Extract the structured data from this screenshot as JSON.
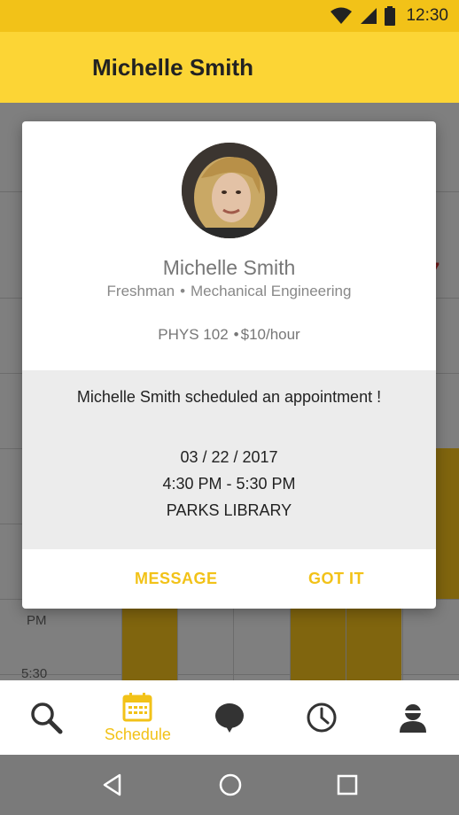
{
  "status_bar": {
    "time": "12:30"
  },
  "app_bar": {
    "title": "Michelle Smith"
  },
  "background": {
    "time_labels": [
      "PM",
      "5:30"
    ],
    "partial_date_digit": "7"
  },
  "dialog": {
    "name": "Michelle Smith",
    "year": "Freshman",
    "major": "Mechanical Engineering",
    "course": "PHYS 102",
    "rate": "$10/hour",
    "message": "Michelle Smith scheduled an appointment !",
    "date": "03 / 22 / 2017",
    "time_range": "4:30 PM - 5:30 PM",
    "location": "PARKS LIBRARY",
    "actions": {
      "message": "MESSAGE",
      "got_it": "GOT IT"
    }
  },
  "bottom_nav": {
    "active_label": "Schedule",
    "items": [
      {
        "icon": "search-icon"
      },
      {
        "icon": "calendar-icon",
        "label": "Schedule"
      },
      {
        "icon": "chat-bubble-icon"
      },
      {
        "icon": "clock-icon"
      },
      {
        "icon": "profile-icon"
      }
    ]
  },
  "colors": {
    "accent": "#f2c218",
    "app_bar": "#fcd535",
    "slot": "#f5c21b"
  }
}
